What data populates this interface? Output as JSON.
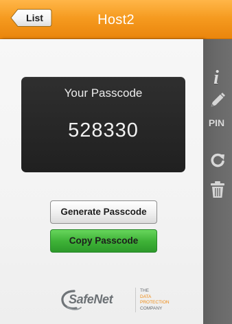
{
  "header": {
    "title": "Host2",
    "back_label": "List",
    "bg_color": "#f39414"
  },
  "main": {
    "passcode_title": "Your Passcode",
    "passcode_value": "528330",
    "generate_label": "Generate Passcode",
    "copy_label": "Copy Passcode",
    "copy_button_color": "#40b43a"
  },
  "sidebar": {
    "items": [
      {
        "id": "info",
        "icon": "info-icon"
      },
      {
        "id": "edit",
        "icon": "pencil-icon"
      },
      {
        "id": "pin",
        "label": "PIN",
        "icon": "pin-label"
      },
      {
        "id": "refresh",
        "icon": "refresh-icon"
      },
      {
        "id": "delete",
        "icon": "trash-icon"
      }
    ]
  },
  "logo": {
    "wordmark": "SafeNet",
    "tagline": [
      "THE",
      "DATA",
      "PROTECTION",
      "COMPANY"
    ]
  }
}
